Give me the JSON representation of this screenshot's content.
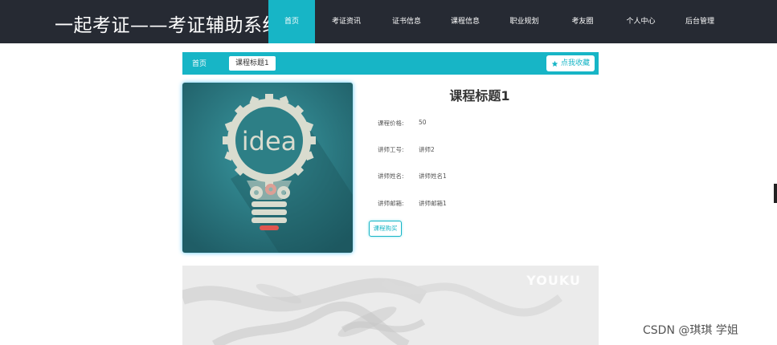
{
  "header": {
    "site_title": "一起考证——考证辅助系统",
    "nav": [
      {
        "label": "首页",
        "active": true
      },
      {
        "label": "考证资讯",
        "active": false
      },
      {
        "label": "证书信息",
        "active": false
      },
      {
        "label": "课程信息",
        "active": false
      },
      {
        "label": "职业规划",
        "active": false
      },
      {
        "label": "考友圈",
        "active": false
      },
      {
        "label": "个人中心",
        "active": false
      },
      {
        "label": "后台管理",
        "active": false
      }
    ]
  },
  "breadcrumb": {
    "home": "首页",
    "current": "课程标题1",
    "favorite_label": "点我收藏"
  },
  "course": {
    "cover_text": "idea",
    "title": "课程标题1",
    "fields": [
      {
        "label": "课程价格:",
        "value": "50"
      },
      {
        "label": "讲师工号:",
        "value": "讲师2"
      },
      {
        "label": "讲师姓名:",
        "value": "讲师姓名1"
      },
      {
        "label": "讲师邮箱:",
        "value": "讲师邮箱1"
      }
    ],
    "buy_label": "课程购买"
  },
  "video": {
    "brand": "YOUKU"
  },
  "watermark": "CSDN @琪琪 学姐",
  "colors": {
    "header_bg": "#262a33",
    "accent": "#17b5c6",
    "cover_bg": "#2d7f86"
  }
}
